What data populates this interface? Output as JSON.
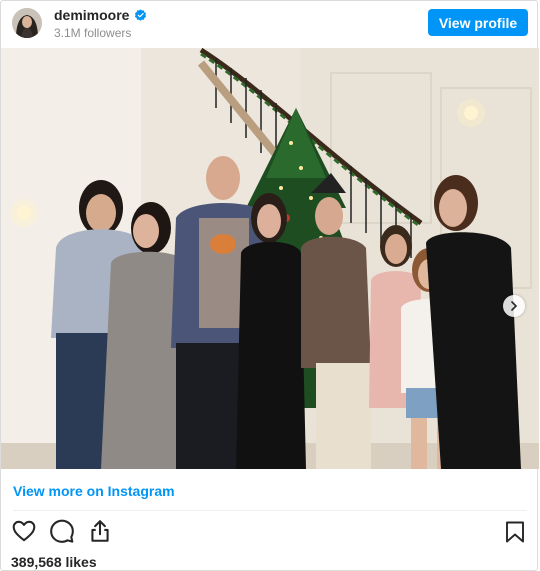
{
  "header": {
    "username": "demimoore",
    "followers": "3.1M followers",
    "view_profile_label": "View profile",
    "avatar_icon": "profile-photo",
    "verified_icon": "verified-badge-icon"
  },
  "post": {
    "carousel": {
      "total": 4,
      "active": 0
    },
    "view_more_label": "View more on Instagram",
    "likes": "389,568 likes",
    "actions": [
      "heart-icon",
      "comment-icon",
      "share-icon",
      "bookmark-icon"
    ]
  },
  "colors": {
    "accent": "#0095f6",
    "text": "#262626",
    "muted": "#8e8e8e",
    "border": "#dbdbdb"
  }
}
